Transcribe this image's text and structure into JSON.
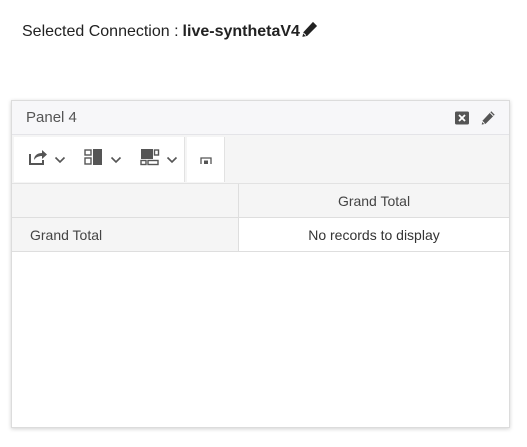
{
  "connection": {
    "label": "Selected Connection :",
    "name": "live-synthetaV4",
    "edit_icon": "pencil-icon"
  },
  "panel": {
    "title": "Panel 4",
    "actions": [
      "close-box-icon",
      "pencil-icon"
    ]
  },
  "toolbar": {
    "buttons": [
      {
        "icon": "export-icon"
      },
      {
        "icon": "column-layout-icon"
      },
      {
        "icon": "row-layout-icon"
      }
    ],
    "small_icon": "fit-icon"
  },
  "grid": {
    "column_header": "Grand Total",
    "row_header": "Grand Total",
    "empty_message": "No records to display"
  },
  "colors": {
    "header_bg": "#f7f7f9",
    "icon": "#555555",
    "border": "#dedede"
  }
}
